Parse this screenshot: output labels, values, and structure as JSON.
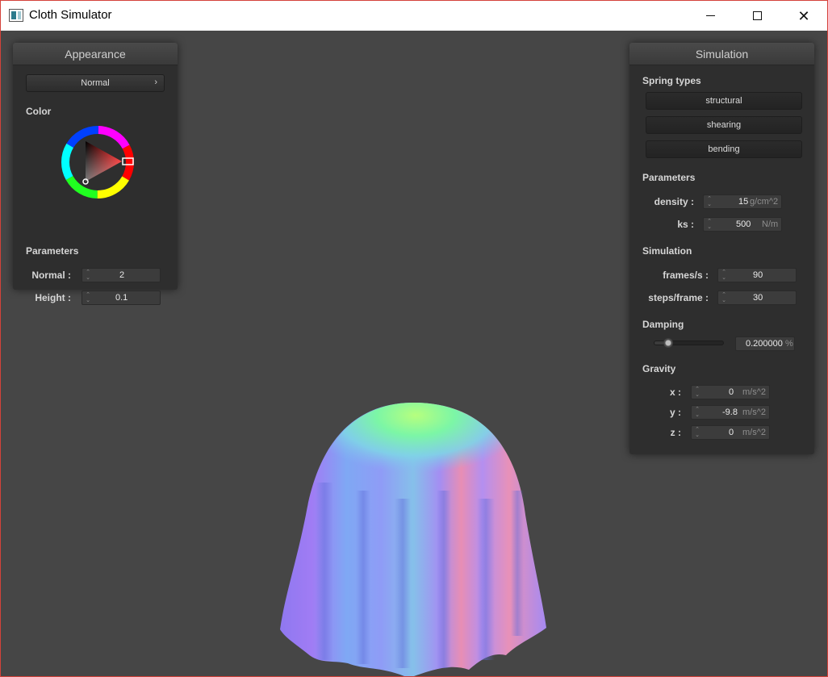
{
  "window": {
    "title": "Cloth Simulator",
    "minimize_icon": "minimize-icon",
    "maximize_icon": "maximize-icon",
    "close_icon": "close-icon",
    "close_glyph": "✕"
  },
  "appearance": {
    "title": "Appearance",
    "shader": {
      "selected": "Normal",
      "chevron": "›"
    },
    "color_label": "Color",
    "color_value": "#e01010",
    "parameters_label": "Parameters",
    "normal": {
      "label": "Normal :",
      "value": "2"
    },
    "height": {
      "label": "Height :",
      "value": "0.1"
    }
  },
  "simulation": {
    "title": "Simulation",
    "spring_types_label": "Spring types",
    "springs": [
      "structural",
      "shearing",
      "bending"
    ],
    "parameters_label": "Parameters",
    "density": {
      "label": "density :",
      "value": "15",
      "unit": "g/cm^2"
    },
    "ks": {
      "label": "ks :",
      "value": "500",
      "unit": "N/m"
    },
    "simulation_label": "Simulation",
    "frames": {
      "label": "frames/s :",
      "value": "90"
    },
    "steps": {
      "label": "steps/frame :",
      "value": "30"
    },
    "damping_label": "Damping",
    "damping": {
      "value": "0.200000",
      "unit": "%",
      "fraction": 0.2
    },
    "gravity_label": "Gravity",
    "gravity": [
      {
        "label": "x :",
        "value": "0",
        "unit": "m/s^2"
      },
      {
        "label": "y :",
        "value": "-9.8",
        "unit": "m/s^2"
      },
      {
        "label": "z :",
        "value": "0",
        "unit": "m/s^2"
      }
    ]
  },
  "colors": {
    "background": "#464646",
    "panel": "#2e2e2e",
    "accent_red": "#e01010"
  }
}
